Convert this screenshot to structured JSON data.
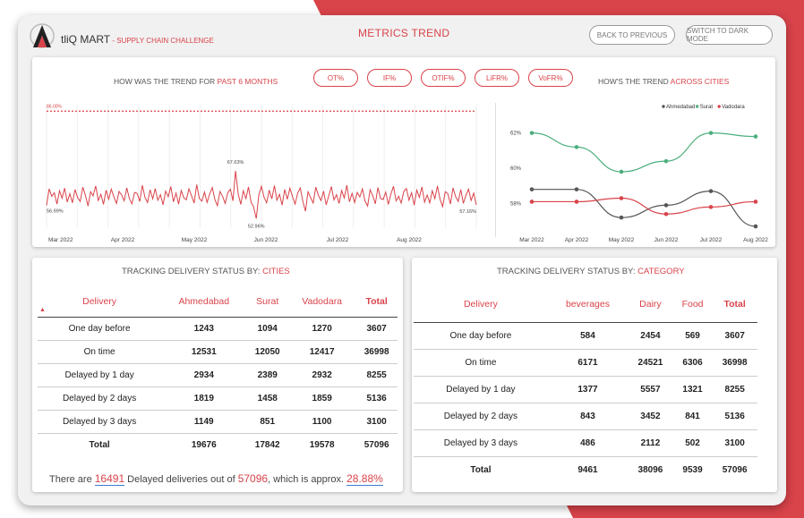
{
  "header": {
    "brand": "tliQ MART",
    "brand_sep": " - ",
    "brand_sub": "SUPPLY CHAIN CHALLENGE",
    "title": "METRICS TREND",
    "back_label": "BACK TO PREVIOUS",
    "dark_label": "SWITCH TO DARK MODE"
  },
  "trend": {
    "title_prefix": "HOW WAS THE TREND FOR ",
    "title_highlight": "PAST 6 MONTHS",
    "metrics": [
      "OT%",
      "IF%",
      "OTIF%",
      "LiFR%",
      "VoFR%"
    ],
    "target_label": "86.00%",
    "annotations": {
      "start": "56.99%",
      "max": "67.63%",
      "min": "52.96%",
      "end": "57.16%"
    },
    "x_labels": [
      "Mar 2022",
      "Apr 2022",
      "May 2022",
      "Jun 2022",
      "Jul 2022",
      "Aug 2022"
    ]
  },
  "cities_trend": {
    "title_prefix": "HOW'S THE TREND ",
    "title_highlight": "ACROSS CITIES",
    "y_labels": [
      "62%",
      "60%",
      "58%"
    ]
  },
  "chart_data": [
    {
      "type": "line",
      "title": "HOW WAS THE TREND FOR PAST 6 MONTHS",
      "target": 86.0,
      "ylim": [
        50,
        88
      ],
      "x_ticks": [
        "Mar 2022",
        "Apr 2022",
        "May 2022",
        "Jun 2022",
        "Jul 2022",
        "Aug 2022"
      ],
      "values": [
        57.0,
        62.1,
        59.8,
        60.9,
        57.4,
        61.5,
        59.2,
        62.3,
        58.0,
        60.6,
        57.8,
        61.9,
        59.4,
        58.2,
        62.6,
        60.1,
        56.8,
        61.2,
        59.9,
        63.0,
        58.5,
        60.4,
        57.3,
        61.7,
        58.9,
        62.0,
        59.6,
        57.6,
        61.3,
        60.2,
        58.4,
        62.4,
        59.1,
        57.5,
        61.0,
        60.7,
        58.2,
        63.2,
        59.5,
        57.9,
        61.8,
        59.0,
        62.2,
        58.6,
        60.3,
        57.2,
        61.4,
        59.7,
        62.8,
        58.1,
        60.8,
        57.4,
        61.6,
        59.3,
        58.7,
        62.1,
        60.0,
        57.7,
        63.4,
        59.2,
        58.3,
        61.1,
        57.9,
        60.5,
        62.5,
        58.8,
        56.9,
        61.3,
        59.8,
        57.6,
        60.9,
        62.0,
        58.4,
        67.63,
        60.6,
        57.3,
        61.5,
        59.1,
        62.7,
        58.0,
        56.5,
        52.96,
        60.2,
        62.9,
        59.5,
        57.8,
        61.7,
        59.0,
        63.1,
        58.6,
        60.4,
        57.1,
        61.9,
        58.9,
        62.3,
        59.7,
        57.4,
        60.8,
        62.4,
        58.2,
        55.2,
        61.2,
        59.4,
        57.7,
        62.6,
        60.1,
        58.5,
        61.4,
        57.2,
        59.9,
        62.8,
        58.7,
        60.3,
        57.6,
        61.6,
        59.3,
        63.2,
        58.1,
        60.7,
        57.9,
        61.0,
        59.6,
        62.1,
        58.3,
        56.8,
        61.8,
        60.0,
        57.5,
        62.5,
        59.2,
        58.8,
        61.1,
        57.3,
        60.5,
        62.9,
        58.4,
        59.8,
        57.7,
        61.3,
        62.2,
        58.6,
        60.9,
        57.1,
        61.7,
        59.5,
        62.7,
        58.0,
        60.2,
        57.8,
        61.5,
        59.1,
        63.0,
        58.9,
        56.6,
        61.2,
        60.6,
        57.4,
        62.4,
        59.7,
        58.2,
        61.9,
        57.6,
        60.1,
        62.0,
        58.5,
        60.8,
        57.16
      ]
    },
    {
      "type": "line",
      "title": "HOW'S THE TREND ACROSS CITIES",
      "categories": [
        "Mar 2022",
        "Apr 2022",
        "May 2022",
        "Jun 2022",
        "Jul 2022",
        "Aug 2022"
      ],
      "ylim": [
        56.6,
        63.2
      ],
      "legend": "top-right",
      "series": [
        {
          "name": "Ahmedabad",
          "color": "#555555",
          "values": [
            58.8,
            58.8,
            57.2,
            57.9,
            58.7,
            56.7
          ]
        },
        {
          "name": "Surat",
          "color": "#4caf7d",
          "values": [
            62.0,
            61.2,
            59.8,
            60.4,
            62.0,
            61.8
          ]
        },
        {
          "name": "Vadodara",
          "color": "#d9434a",
          "values": [
            58.1,
            58.1,
            58.3,
            57.4,
            57.8,
            58.1
          ]
        }
      ]
    }
  ],
  "cities_table": {
    "title_prefix": "TRACKING DELIVERY STATUS BY: ",
    "title_highlight": "CITIES",
    "headers": [
      "Delivery",
      "Ahmedabad",
      "Surat",
      "Vadodara",
      "Total"
    ],
    "rows": [
      [
        "One day before",
        "1243",
        "1094",
        "1270",
        "3607"
      ],
      [
        "On time",
        "12531",
        "12050",
        "12417",
        "36998"
      ],
      [
        "Delayed by 1 day",
        "2934",
        "2389",
        "2932",
        "8255"
      ],
      [
        "Delayed by 2 days",
        "1819",
        "1458",
        "1859",
        "5136"
      ],
      [
        "Delayed by 3 days",
        "1149",
        "851",
        "1100",
        "3100"
      ]
    ],
    "total": [
      "Total",
      "19676",
      "17842",
      "19578",
      "57096"
    ]
  },
  "category_table": {
    "title_prefix": "TRACKING DELIVERY STATUS BY: ",
    "title_highlight": "CATEGORY",
    "headers": [
      "Delivery",
      "beverages",
      "Dairy",
      "Food",
      "Total"
    ],
    "rows": [
      [
        "One day before",
        "584",
        "2454",
        "569",
        "3607"
      ],
      [
        "On time",
        "6171",
        "24521",
        "6306",
        "36998"
      ],
      [
        "Delayed by 1 day",
        "1377",
        "5557",
        "1321",
        "8255"
      ],
      [
        "Delayed by 2 days",
        "843",
        "3452",
        "841",
        "5136"
      ],
      [
        "Delayed by 3 days",
        "486",
        "2112",
        "502",
        "3100"
      ]
    ],
    "total": [
      "Total",
      "9461",
      "38096",
      "9539",
      "57096"
    ]
  },
  "summary": {
    "p1": "There are ",
    "delayed": "16491",
    "p2": " Delayed deliveries out of ",
    "total": "57096",
    "p3": ", which is approx. ",
    "pct": "28.88%"
  },
  "colors": {
    "accent": "#d9434a",
    "surat": "#4caf7d",
    "ahmedabad": "#555555"
  }
}
